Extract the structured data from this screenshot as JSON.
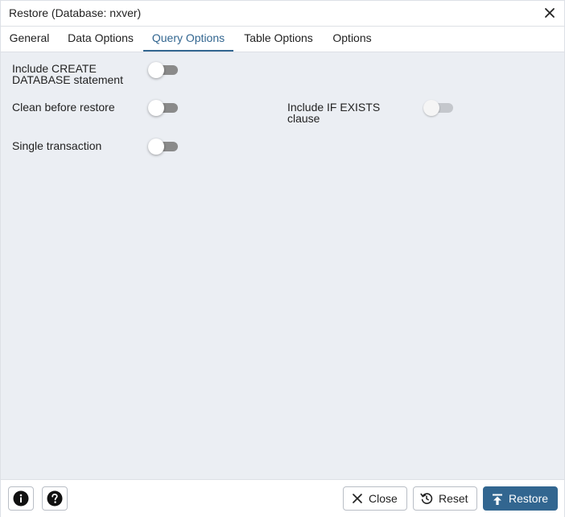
{
  "dialog": {
    "title": "Restore (Database: nxver)",
    "close_icon": "close-icon"
  },
  "tabs": [
    {
      "label": "General",
      "active": false
    },
    {
      "label": "Data Options",
      "active": false
    },
    {
      "label": "Query Options",
      "active": true
    },
    {
      "label": "Table Options",
      "active": false
    },
    {
      "label": "Options",
      "active": false
    }
  ],
  "options": {
    "include_create": {
      "label_line1": "Include CREATE",
      "label_line2": "DATABASE statement",
      "enabled": false,
      "disabled": false
    },
    "clean_before_restore": {
      "label": "Clean before restore",
      "enabled": false,
      "disabled": false
    },
    "include_if_exists": {
      "label_line1": "Include IF EXISTS",
      "label_line2": "clause",
      "enabled": false,
      "disabled": true
    },
    "single_transaction": {
      "label": "Single transaction",
      "enabled": false,
      "disabled": false
    }
  },
  "footer": {
    "info_icon": "info-icon",
    "help_icon": "help-icon",
    "close_label": "Close",
    "reset_label": "Reset",
    "restore_label": "Restore"
  },
  "colors": {
    "accent": "#326690",
    "content_bg": "#ebeef3",
    "toggle_off": "#8a8a8a",
    "toggle_disabled": "#c4c7cc"
  }
}
